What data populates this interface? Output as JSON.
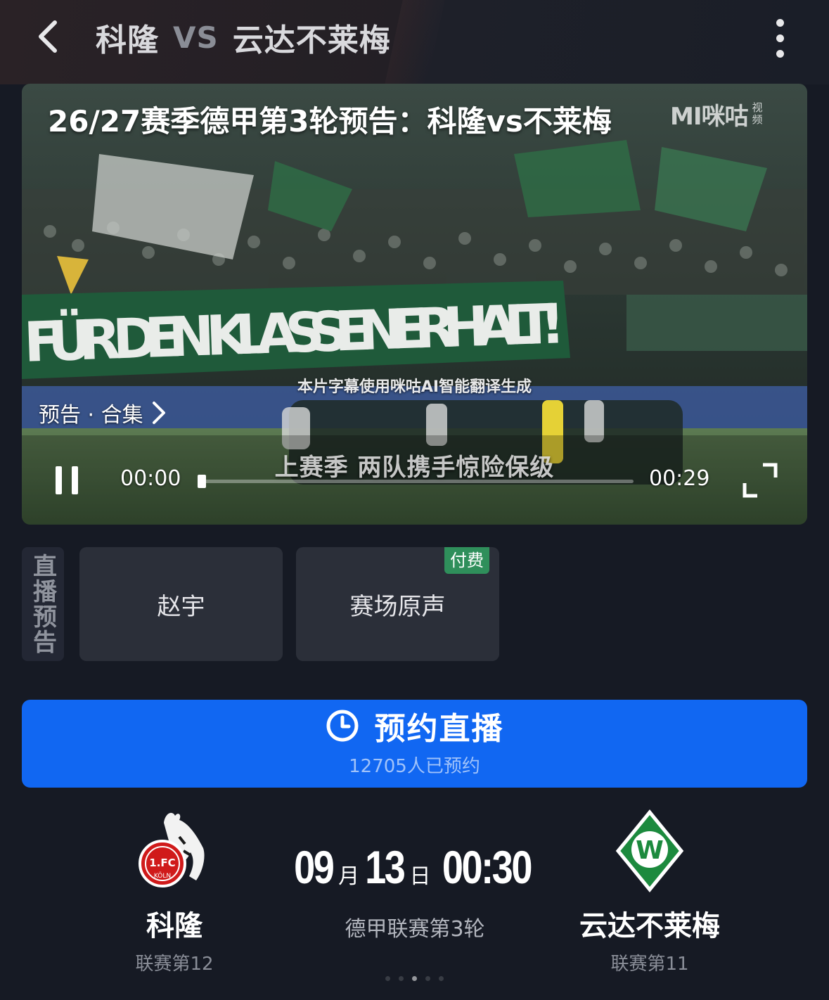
{
  "header": {
    "back_icon": "chevron-left-icon",
    "home_team": "科隆",
    "vs": "VS",
    "away_team": "云达不莱梅",
    "more_icon": "more-vertical-icon"
  },
  "video": {
    "title": "26/27赛季德甲第3轮预告：科隆vs不莱梅",
    "watermark": "MIGU视频",
    "watermark_main": "MI咪咕",
    "watermark_sub": "视频",
    "banner_text": "FÜR DEN KLASSENERHALT!",
    "ai_subtitle_note": "本片字幕使用咪咕AI智能翻译生成",
    "collection_link": "预告 · 合集",
    "subtitle": "上赛季 两队携手惊险保级",
    "current_time": "00:00",
    "total_time": "00:29",
    "progress": 0.0,
    "accent_color": "#1f8bff"
  },
  "commentary": {
    "section_label": "直播预告",
    "options": [
      {
        "label": "赵宇",
        "badge": ""
      },
      {
        "label": "赛场原声",
        "badge": "付费"
      }
    ],
    "paid_color": "#2f8f5b"
  },
  "reserve": {
    "label": "预约直播",
    "icon": "clock-icon",
    "count_text": "12705人已预约",
    "color": "#1167f2"
  },
  "match": {
    "home": {
      "name": "科隆",
      "rank": "联赛第12",
      "logo": "fc-koln-logo"
    },
    "away": {
      "name": "云达不莱梅",
      "rank": "联赛第11",
      "logo": "werder-bremen-logo"
    },
    "month": "09",
    "month_unit": "月",
    "day": "13",
    "day_unit": "日",
    "time": "00:30",
    "competition": "德甲联赛第3轮"
  }
}
